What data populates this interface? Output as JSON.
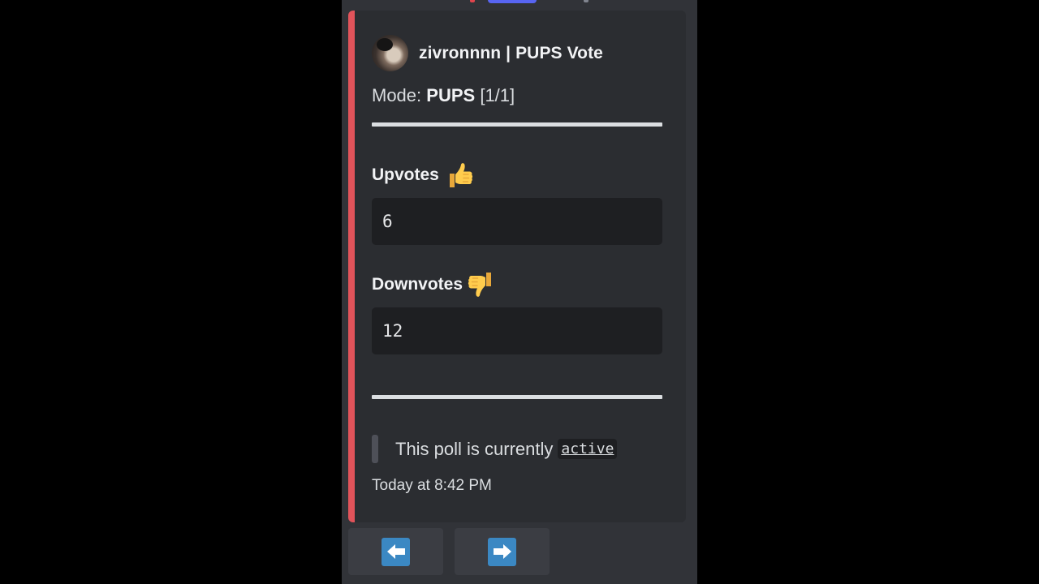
{
  "embed": {
    "accent_color": "#e1535a",
    "author": {
      "name": "zivronnnn | PUPS Vote",
      "avatar": "user-avatar"
    },
    "mode": {
      "label": "Mode:",
      "value": "PUPS",
      "page": "[1/1]"
    },
    "fields": [
      {
        "name": "Upvotes",
        "emoji": "thumbs-up-icon",
        "value": "6"
      },
      {
        "name": "Downvotes",
        "emoji": "thumbs-down-icon",
        "value": "12"
      }
    ],
    "status": {
      "text": "This poll is currently",
      "code": "active"
    },
    "timestamp": "Today at 8:42 PM"
  },
  "buttons": [
    {
      "icon": "left-arrow-icon"
    },
    {
      "icon": "right-arrow-icon"
    }
  ]
}
